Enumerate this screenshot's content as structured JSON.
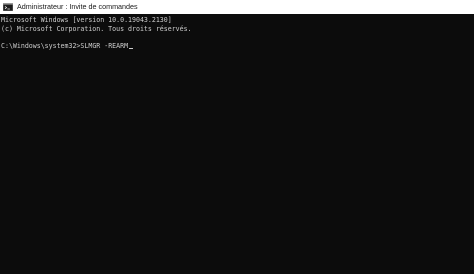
{
  "window": {
    "title": "Administrateur : Invite de commandes",
    "icon": "cmd-icon"
  },
  "console": {
    "line1": "Microsoft Windows [version 10.0.19043.2130]",
    "line2": "(c) Microsoft Corporation. Tous droits réservés.",
    "prompt": "C:\\Windows\\system32>",
    "command": "SLMGR -REARM"
  },
  "colors": {
    "console_background": "#0c0c0c",
    "console_text": "#cccccc",
    "titlebar_background": "#ffffff"
  }
}
